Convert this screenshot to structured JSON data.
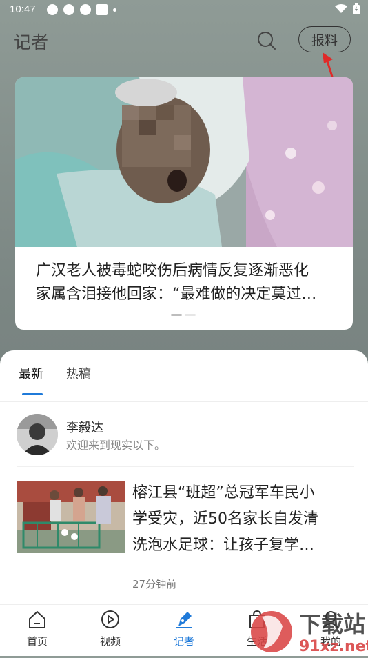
{
  "status_bar": {
    "time": "10:47"
  },
  "header": {
    "title": "记者",
    "report_button": "报料"
  },
  "featured": {
    "title_lines": [
      "广汉老人被毒蛇咬伤后病情反复逐渐恶化",
      "家属含泪接他回家：“最难做的决定莫过…"
    ],
    "page_count": 2,
    "active_page": 1
  },
  "tabs": [
    {
      "label": "最新",
      "active": true
    },
    {
      "label": "热稿",
      "active": false
    }
  ],
  "author": {
    "name": "李毅达",
    "bio": "欢迎来到现实以下。"
  },
  "news": {
    "title_lines": [
      "榕江县“班超”总冠军车民小",
      "学受灾，近50名家长自发清",
      "洗泡水足球：让孩子复学…"
    ],
    "time": "27分钟前"
  },
  "nav": [
    {
      "label": "首页",
      "icon": "home-icon",
      "active": false
    },
    {
      "label": "视频",
      "icon": "play-icon",
      "active": false
    },
    {
      "label": "记者",
      "icon": "pen-icon",
      "active": true
    },
    {
      "label": "生活",
      "icon": "bag-icon",
      "active": false
    },
    {
      "label": "我的",
      "icon": "user-icon",
      "active": false
    }
  ],
  "watermark": {
    "text_cn": "下载站",
    "text_url": "91xz.net"
  },
  "colors": {
    "accent": "#1f7ad9",
    "annotation_arrow": "#e02a2a"
  }
}
